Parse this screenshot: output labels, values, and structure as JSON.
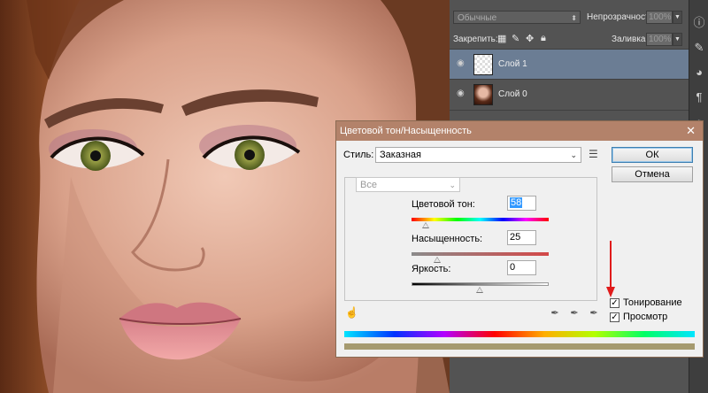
{
  "layers_panel": {
    "blend_mode": "Обычные",
    "opacity_label": "Непрозрачность:",
    "opacity_value": "100%",
    "lock_label": "Закрепить:",
    "fill_label": "Заливка:",
    "fill_value": "100%",
    "layers": [
      {
        "name": "Слой 1",
        "selected": true
      },
      {
        "name": "Слой 0",
        "selected": false
      }
    ]
  },
  "dialog": {
    "title": "Цветовой тон/Насыщенность",
    "style_label": "Стиль:",
    "style_value": "Заказная",
    "channel_value": "Все",
    "hue_label": "Цветовой тон:",
    "hue_value": "58",
    "saturation_label": "Насыщенность:",
    "saturation_value": "25",
    "lightness_label": "Яркость:",
    "lightness_value": "0",
    "ok_label": "ОК",
    "cancel_label": "Отмена",
    "colorize_label": "Тонирование",
    "colorize_checked": true,
    "preview_label": "Просмотр",
    "preview_checked": true
  },
  "colors": {
    "accent_title": "#b3826a",
    "arrow": "#e01b1b",
    "layer_selected": "#6b7d94"
  }
}
